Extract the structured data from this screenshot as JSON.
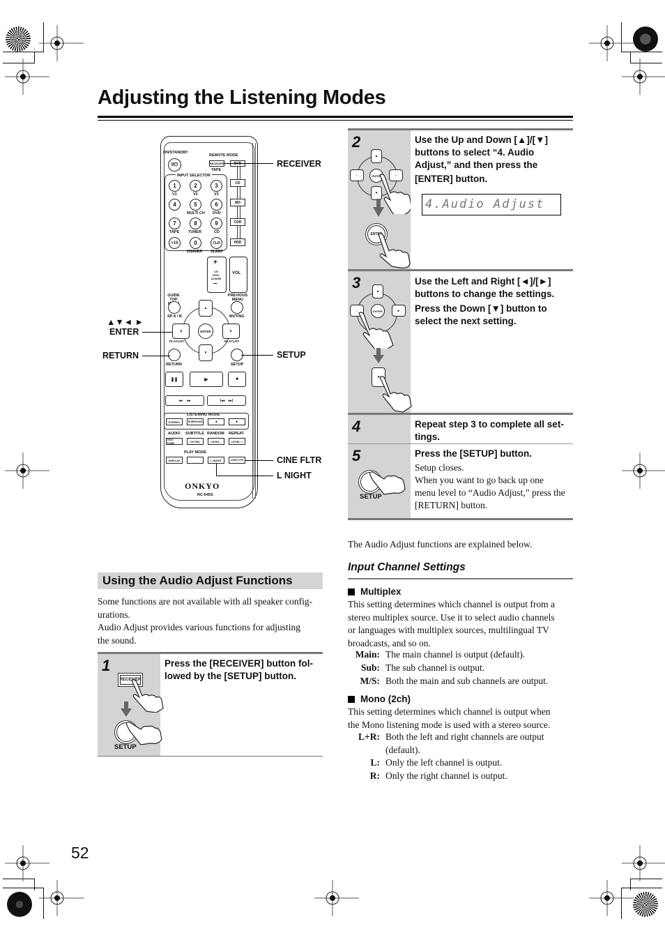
{
  "page": {
    "title": "Adjusting the Listening Modes",
    "page_number": "52"
  },
  "remote": {
    "model": "RC-645S",
    "brand": "ONKYO",
    "labels": {
      "on_standby": "ON/STANDBY",
      "remote_mode": "REMOTE MODE",
      "receiver": "RECEIVER",
      "dvd": "DVD",
      "tape": "TAPE",
      "input_selector": "INPUT SELECTOR",
      "cd": "CD",
      "md": "MD",
      "cdr": "CDR",
      "hdd": "HDD",
      "v1": "V1",
      "v2": "V2",
      "v3": "V3",
      "multi_ch": "MULTI CH",
      "dvd_sub": "DVD",
      "tape_sub": "TAPE",
      "tuner": "TUNER",
      "cd_sub": "CD",
      "dimmer": "DIMMER",
      "sleep": "SLEEP",
      "vol": "VOL",
      "ch_disc_album": "CH DISC ALBUM",
      "guide_top_menu": "GUIDE TOP MENU",
      "previous_menu": "PREVIOUS MENU",
      "sp_ab": "SP A / B",
      "muting": "MUTING",
      "enter": "ENTER",
      "playlist_left": "PLAYLIST",
      "playlist_right": "PLAYLIST",
      "return": "RETURN",
      "setup": "SETUP",
      "listening_mode": "LISTENING MODE",
      "stereo": "STEREO",
      "surround": "SURROUND",
      "audio": "AUDIO",
      "subtitle": "SUBTITLE",
      "random": "RANDOM",
      "repeat": "REPEAT",
      "test_tone": "TEST TONE",
      "ch_sel": "CH SEL",
      "level_minus": "LEVEL -",
      "level_plus": "LEVEL +",
      "play_mode": "PLAY MODE",
      "display": "DISPLAY",
      "l_night": "L NIGHT",
      "cine_fltr": "CINE FLTR"
    },
    "number_keys": [
      "1",
      "2",
      "3",
      "4",
      "5",
      "6",
      "7",
      "8",
      "9",
      "+10",
      "0",
      "CLR"
    ],
    "callouts": {
      "receiver": "RECEIVER",
      "arrows": "▲▼◄ ►",
      "enter": "ENTER",
      "return": "RETURN",
      "setup": "SETUP",
      "cine_fltr": "CINE FLTR",
      "l_night": "L NIGHT"
    }
  },
  "section": {
    "heading": "Using the Audio Adjust Functions",
    "intro_1": "Some functions are not available with all speaker configurations.",
    "intro_1a": "Some functions are not available with all speaker config-",
    "intro_1b": "urations.",
    "intro_2a": "Audio Adjust provides various functions for adjusting",
    "intro_2b": "the sound."
  },
  "steps": [
    {
      "number": "1",
      "text_a": "Press the [RECEIVER] button fol-",
      "text_b": "lowed by the [SETUP] button.",
      "icon_button": "RECEIVER",
      "icon_label": "SETUP"
    },
    {
      "number": "2",
      "text_a": "Use the Up and Down [▲]/[▼]",
      "text_b": "buttons to select “4. Audio",
      "text_c": "Adjust,” and then press the",
      "text_d": "[ENTER] button.",
      "display": "4.Audio Adjust",
      "icon_label": "ENTER"
    },
    {
      "number": "3",
      "text_a": "Use the Left and Right [◄]/[►]",
      "text_b": "buttons to change the settings.",
      "text_c": "Press the Down [▼] button to",
      "text_d": "select the next setting.",
      "icon_label": "ENTER"
    },
    {
      "number": "4",
      "text_a": "Repeat step 3 to complete all set-",
      "text_b": "tings."
    },
    {
      "number": "5",
      "text_a": "Press the [SETUP] button.",
      "body_1": "Setup closes.",
      "body_2a": "When you want to go back up one",
      "body_2b": "menu level to “Audio Adjust,” press the",
      "body_2c": "[RETURN] button.",
      "icon_label": "SETUP"
    }
  ],
  "explain": "The Audio Adjust functions are explained below.",
  "input_channel": {
    "heading": "Input Channel Settings",
    "multiplex": {
      "title": "Multiplex",
      "lines": [
        "This setting determines which channel is output from a",
        "stereo multiplex source. Use it to select audio channels",
        "or languages with multiplex sources, multilingual TV",
        "broadcasts, and so on."
      ],
      "options": [
        {
          "term": "Main:",
          "desc": "The main channel is output (default)."
        },
        {
          "term": "Sub:",
          "desc": "The sub channel is output."
        },
        {
          "term": "M/S:",
          "desc": "Both the main and sub channels are output."
        }
      ]
    },
    "mono": {
      "title": "Mono (2ch)",
      "lines": [
        "This setting determines which channel is output when",
        "the Mono listening mode is used with a stereo source."
      ],
      "options": [
        {
          "term": "L+R:",
          "desc": "Both the left and right channels are output",
          "desc2": "(default)."
        },
        {
          "term": "L:",
          "desc": "Only the left channel is output."
        },
        {
          "term": "R:",
          "desc": "Only the right channel is output."
        }
      ]
    }
  },
  "colors": {
    "step_panel": "#d4d4d4",
    "rule": "#777777",
    "lcd_text": "#777777"
  }
}
